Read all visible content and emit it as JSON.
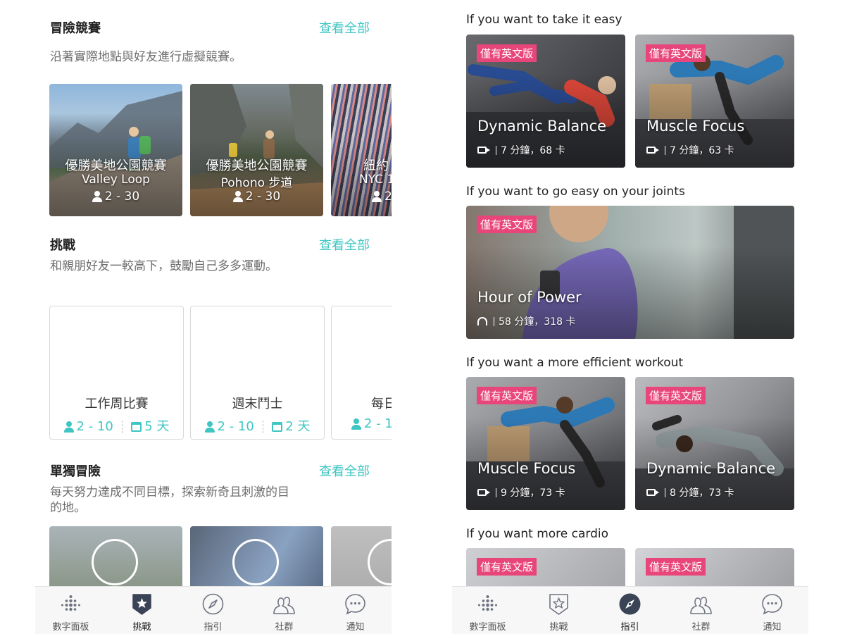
{
  "left": {
    "races": {
      "title": "冒險競賽",
      "see_all": "查看全部",
      "desc": "沿著實際地點與好友進行虛擬競賽。",
      "cards": [
        {
          "name": "優勝美地公園競賽",
          "sub": "Valley Loop",
          "players": "2 - 30"
        },
        {
          "name": "優勝美地公園競賽",
          "sub": "Pohono 步道",
          "players": "2 - 30"
        },
        {
          "name": "紐約",
          "sub": "NYC 1",
          "players": "2"
        }
      ]
    },
    "challenges": {
      "title": "挑戰",
      "see_all": "查看全部",
      "desc": "和親朋好友一較高下，鼓勵自己多多運動。",
      "cards": [
        {
          "name": "工作周比賽",
          "players": "2 - 10",
          "days": "5 天"
        },
        {
          "name": "週末鬥士",
          "players": "2 - 10",
          "days": "2 天"
        },
        {
          "name": "每日",
          "players": "2 - 1",
          "days": ""
        }
      ]
    },
    "solo": {
      "title": "單獨冒險",
      "see_all": "查看全部",
      "desc": "每天努力達成不同目標，探索新奇且刺激的目的地。"
    },
    "tabs": [
      {
        "label": "數字面板",
        "icon": "dots-logo-icon"
      },
      {
        "label": "挑戰",
        "icon": "star-badge-icon"
      },
      {
        "label": "指引",
        "icon": "compass-icon"
      },
      {
        "label": "社群",
        "icon": "people-icon"
      },
      {
        "label": "通知",
        "icon": "chat-bubble-icon"
      }
    ],
    "active_tab": 1
  },
  "right": {
    "sections": [
      {
        "heading": "If you want to take it easy"
      },
      {
        "heading": "If you want to go easy on your joints"
      },
      {
        "heading": "If you want a more efficient workout"
      },
      {
        "heading": "If you want more cardio"
      }
    ],
    "badge": "僅有英文版",
    "workouts": [
      {
        "title": "Dynamic Balance",
        "meta": "7 分鐘，68 卡",
        "media": "video-icon"
      },
      {
        "title": "Muscle Focus",
        "meta": "7 分鐘，63 卡",
        "media": "video-icon"
      },
      {
        "title": "Hour of Power",
        "meta": "58 分鐘，318 卡",
        "media": "headphones-icon"
      },
      {
        "title": "Muscle Focus",
        "meta": "9 分鐘，73 卡",
        "media": "video-icon"
      },
      {
        "title": "Dynamic Balance",
        "meta": "8 分鐘，73 卡",
        "media": "video-icon"
      }
    ],
    "tabs": [
      {
        "label": "數字面板",
        "icon": "dots-logo-icon"
      },
      {
        "label": "挑戰",
        "icon": "star-badge-icon"
      },
      {
        "label": "指引",
        "icon": "compass-icon"
      },
      {
        "label": "社群",
        "icon": "people-icon"
      },
      {
        "label": "通知",
        "icon": "chat-bubble-icon"
      }
    ],
    "active_tab": 2
  },
  "colors": {
    "accent_teal": "#3ec6c3",
    "badge_pink": "#e8467b",
    "tab_active": "#3a4456"
  }
}
